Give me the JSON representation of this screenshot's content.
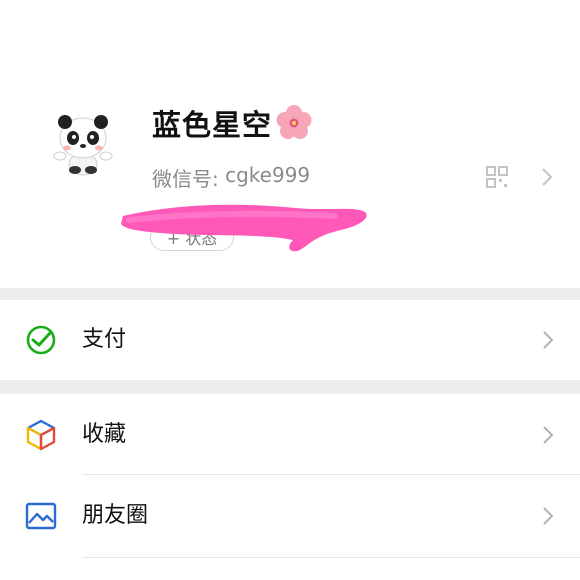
{
  "profile": {
    "nickname": "蓝色星空",
    "flower_icon": "cherry-blossom-icon",
    "wechat_id_label": "微信号: ",
    "wechat_id_value": "cgke999",
    "status_button_label": "+ 状态",
    "avatar_icon": "panda-avatar",
    "qr_icon": "qr-code-icon",
    "scribble_color": "#ff4fb4"
  },
  "menu": {
    "pay": {
      "label": "支付",
      "icon": "wechat-pay-icon",
      "color": "#1aad19"
    },
    "favorites": {
      "label": "收藏",
      "icon": "cube-icon"
    },
    "moments": {
      "label": "朋友圈",
      "icon": "picture-icon",
      "color": "#2c6bd1"
    }
  },
  "colors": {
    "background": "#ededed",
    "card": "#ffffff",
    "chevron": "#b2b2b2"
  }
}
